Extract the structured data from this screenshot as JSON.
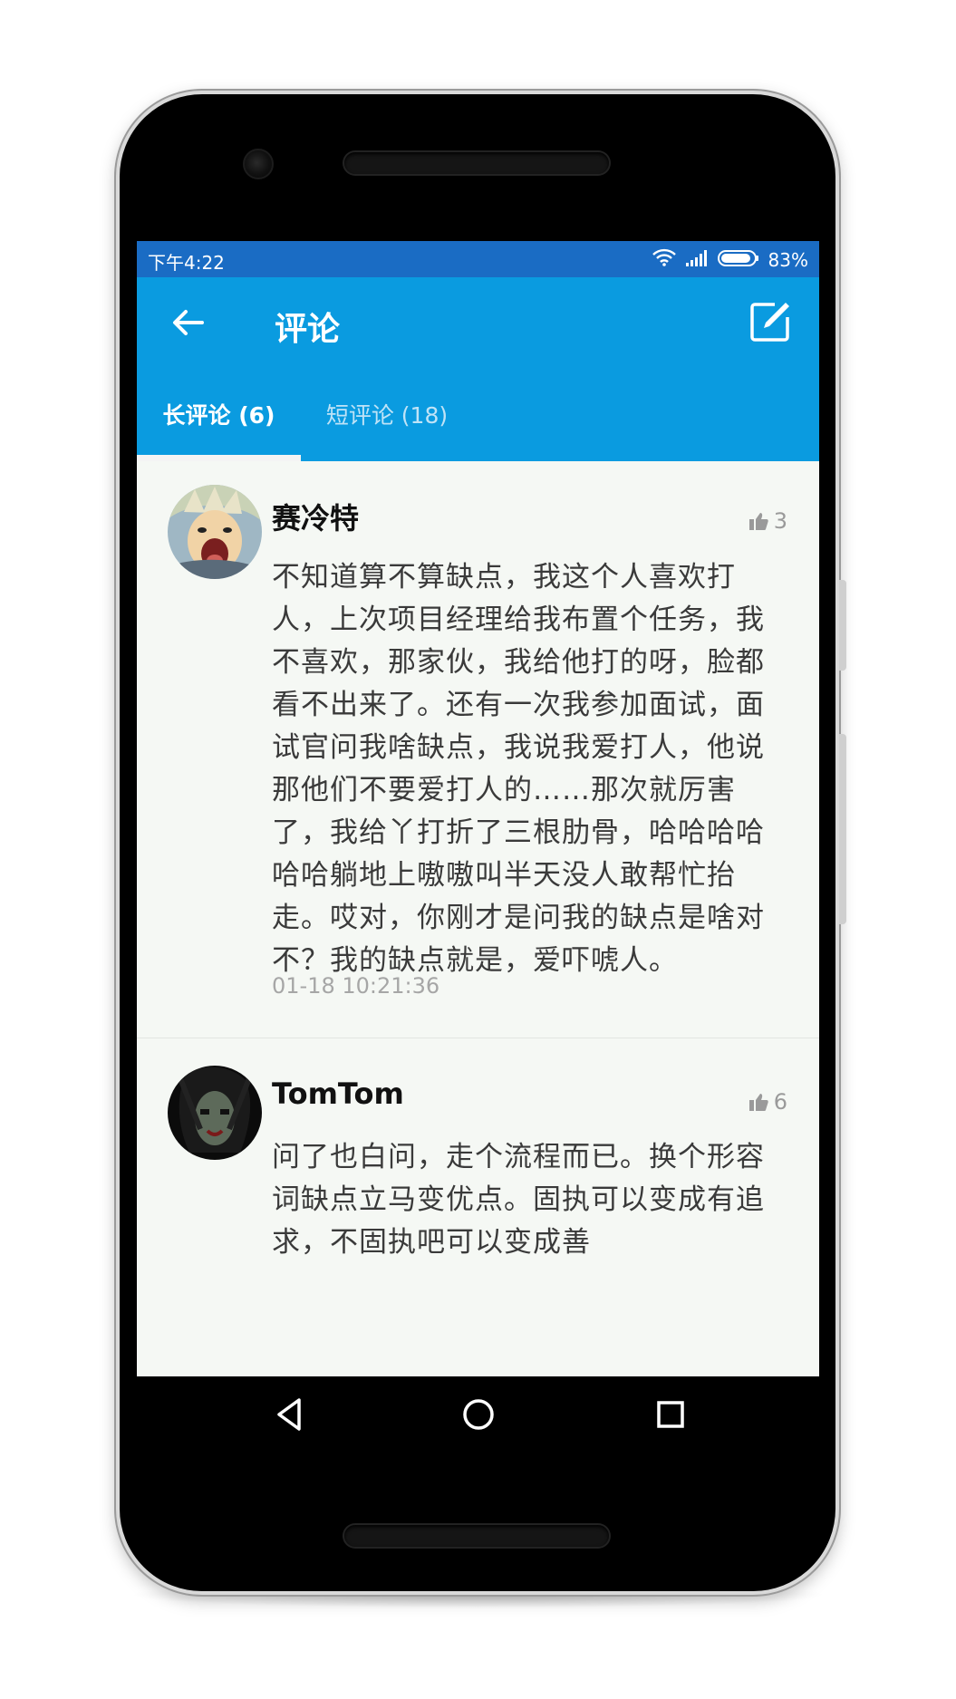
{
  "status_bar": {
    "time": "下午4:22",
    "battery": "83%"
  },
  "app_bar": {
    "title": "评论"
  },
  "tabs": [
    {
      "label": "长评论 (6)",
      "active": true
    },
    {
      "label": "短评论 (18)",
      "active": false
    }
  ],
  "comments": [
    {
      "author": "赛冷特",
      "likes": "3",
      "body": "不知道算不算缺点，我这个人喜欢打人，上次项目经理给我布置个任务，我不喜欢，那家伙，我给他打的呀，脸都看不出来了。还有一次我参加面试，面试官问我啥缺点，我说我爱打人，他说那他们不要爱打人的……那次就厉害了，我给丫打折了三根肋骨，哈哈哈哈哈哈躺地上嗷嗷叫半天没人敢帮忙抬走。哎对，你刚才是问我的缺点是啥对不？我的缺点就是，爱吓唬人。",
      "time": "01-18 10:21:36"
    },
    {
      "author": "TomTom",
      "likes": "6",
      "body": "问了也白问，走个流程而已。换个形容词缺点立马变优点。固执可以变成有追求，不固执吧可以变成善"
    }
  ],
  "colors": {
    "status_bar": "#1a6cc4",
    "app_bar": "#0a9be0",
    "screen_bg": "#f5f8f4"
  }
}
